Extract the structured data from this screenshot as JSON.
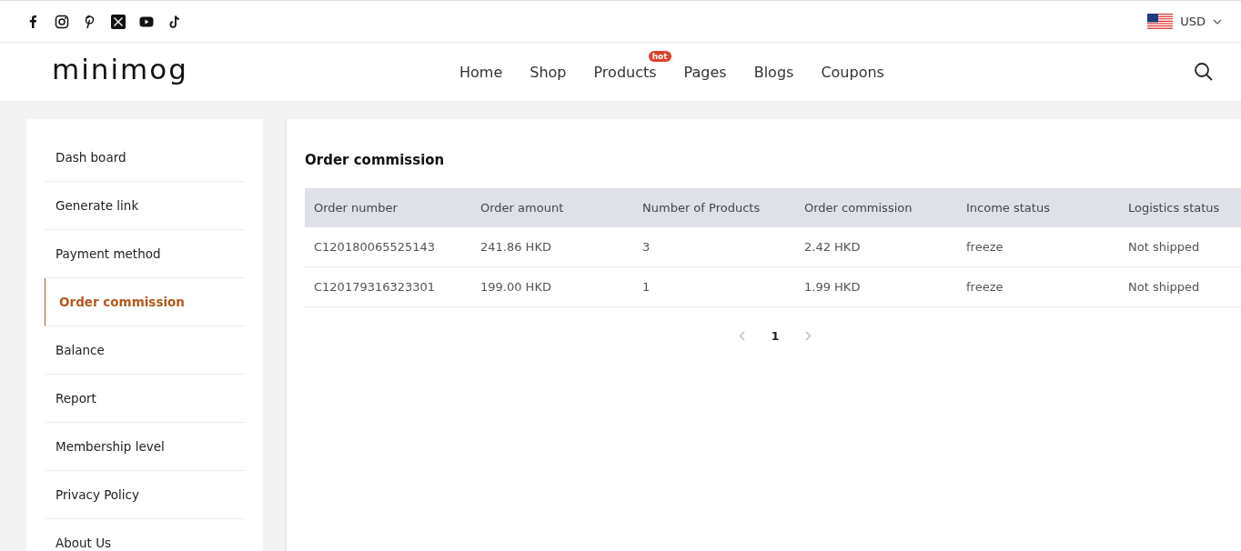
{
  "topbar": {
    "currency": "USD"
  },
  "header": {
    "logo": "minimog",
    "nav": [
      {
        "label": "Home"
      },
      {
        "label": "Shop"
      },
      {
        "label": "Products",
        "badge": "hot"
      },
      {
        "label": "Pages"
      },
      {
        "label": "Blogs"
      },
      {
        "label": "Coupons"
      }
    ]
  },
  "sidebar": {
    "items": [
      {
        "label": "Dash board",
        "selected": false
      },
      {
        "label": "Generate link",
        "selected": false
      },
      {
        "label": "Payment method",
        "selected": false
      },
      {
        "label": "Order commission",
        "selected": true
      },
      {
        "label": "Balance",
        "selected": false
      },
      {
        "label": "Report",
        "selected": false
      },
      {
        "label": "Membership level",
        "selected": false
      },
      {
        "label": "Privacy Policy",
        "selected": false
      },
      {
        "label": "About Us",
        "selected": false
      }
    ]
  },
  "panel": {
    "title": "Order commission",
    "table": {
      "columns": [
        "Order number",
        "Order amount",
        "Number of Products",
        "Order commission",
        "Income status",
        "Logistics status"
      ],
      "rows": [
        [
          "C120180065525143",
          "241.86 HKD",
          "3",
          "2.42 HKD",
          "freeze",
          "Not shipped"
        ],
        [
          "C120179316323301",
          "199.00 HKD",
          "1",
          "1.99 HKD",
          "freeze",
          "Not shipped"
        ]
      ]
    },
    "pagination": {
      "pages": [
        {
          "label": "1",
          "selected": true
        }
      ]
    }
  }
}
